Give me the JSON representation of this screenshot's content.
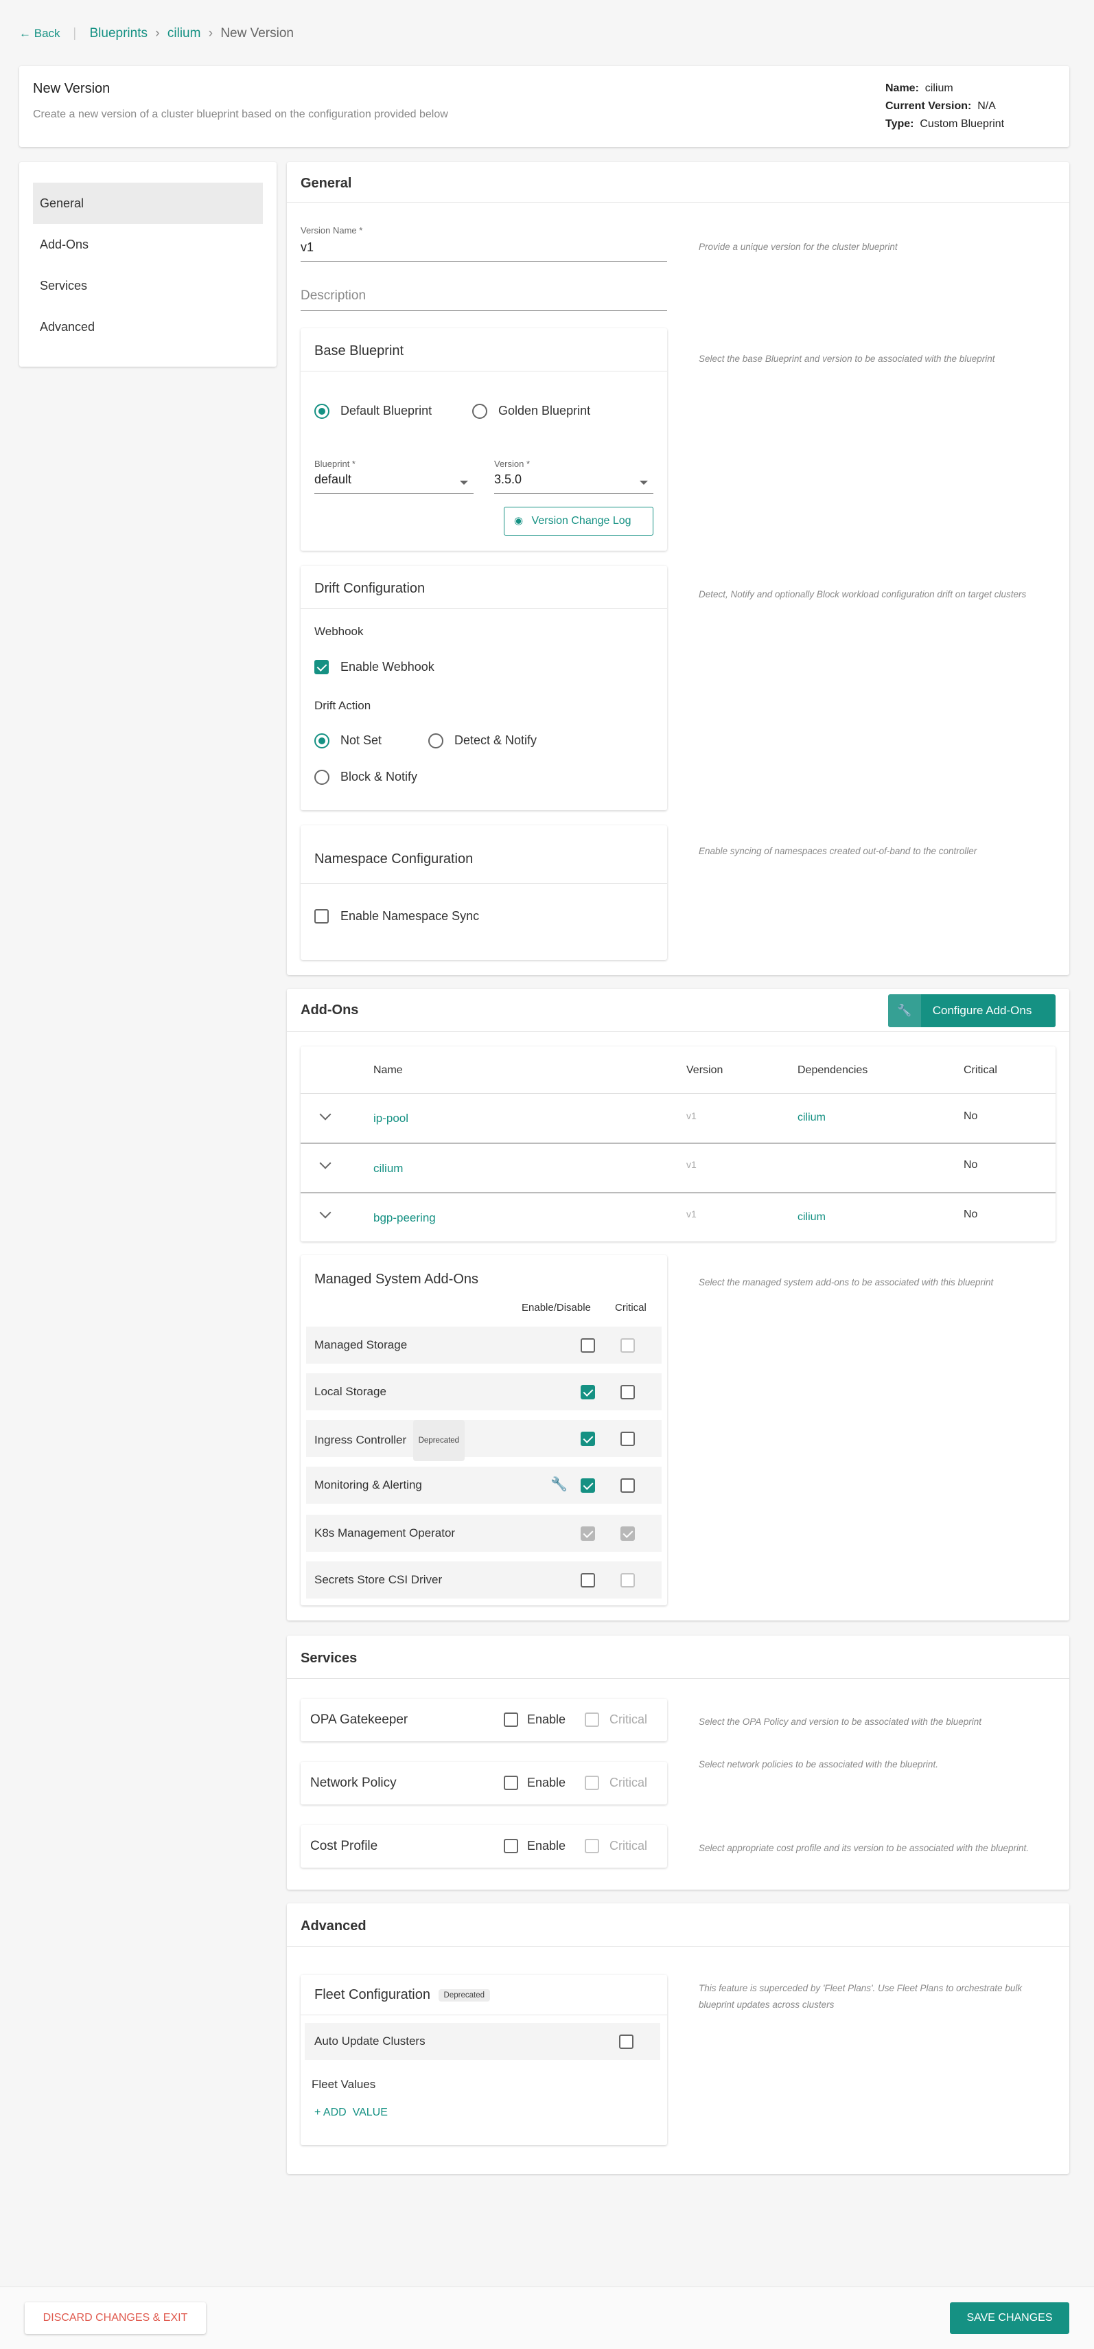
{
  "breadcrumb": {
    "back": "Back",
    "items": [
      "Blueprints",
      "cilium"
    ],
    "separator": "›",
    "current": "New Version"
  },
  "header": {
    "title": "New Version",
    "subtitle": "Create a new version of a cluster blueprint based on the configuration provided below",
    "meta": {
      "name_label": "Name:",
      "name_value": "cilium",
      "version_label": "Current Version:",
      "version_value": "N/A",
      "type_label": "Type:",
      "type_value": "Custom Blueprint"
    }
  },
  "sidebar": {
    "items": [
      {
        "label": "General",
        "active": true
      },
      {
        "label": "Add-Ons",
        "active": false
      },
      {
        "label": "Services",
        "active": false
      },
      {
        "label": "Advanced",
        "active": false
      }
    ]
  },
  "general": {
    "title": "General",
    "version_name_label": "Version Name *",
    "version_name_value": "v1",
    "version_name_hint": "Provide a unique version for the cluster blueprint",
    "description_placeholder": "Description",
    "base_blueprint": {
      "title": "Base Blueprint",
      "hint": "Select the base Blueprint and version to be associated with the blueprint",
      "option_default": "Default Blueprint",
      "option_golden": "Golden Blueprint",
      "selected": "Default Blueprint",
      "blueprint_label": "Blueprint *",
      "blueprint_value": "default",
      "version_label": "Version *",
      "version_value": "3.5.0",
      "change_log_button": "Version Change Log"
    },
    "drift": {
      "title": "Drift Configuration",
      "hint": "Detect, Notify and optionally Block workload configuration drift on target clusters",
      "webhook_label": "Webhook",
      "enable_webhook": "Enable Webhook",
      "enable_webhook_checked": true,
      "action_label": "Drift Action",
      "options": [
        "Not Set",
        "Detect & Notify",
        "Block & Notify"
      ],
      "selected": "Not Set"
    },
    "namespace": {
      "title": "Namespace Configuration",
      "hint": "Enable syncing of namespaces created out-of-band to the controller",
      "enable_sync": "Enable Namespace Sync",
      "enable_sync_checked": false
    }
  },
  "addons": {
    "title": "Add-Ons",
    "configure_button": "Configure Add-Ons",
    "columns": [
      "Name",
      "Version",
      "Dependencies",
      "Critical"
    ],
    "rows": [
      {
        "name": "ip-pool",
        "version": "v1",
        "dependencies": "cilium",
        "critical": "No"
      },
      {
        "name": "cilium",
        "version": "v1",
        "dependencies": "",
        "critical": "No"
      },
      {
        "name": "bgp-peering",
        "version": "v1",
        "dependencies": "cilium",
        "critical": "No"
      }
    ],
    "managed": {
      "title": "Managed System Add-Ons",
      "hint": "Select the managed system add-ons to be associated with this blueprint",
      "col_enable": "Enable/Disable",
      "col_critical": "Critical",
      "rows": [
        {
          "name": "Managed Storage",
          "badge": "",
          "enabled": false,
          "enable_disabled": false,
          "critical": false,
          "critical_disabled": true,
          "wrench": false
        },
        {
          "name": "Local Storage",
          "badge": "",
          "enabled": true,
          "enable_disabled": false,
          "critical": false,
          "critical_disabled": false,
          "wrench": false
        },
        {
          "name": "Ingress Controller",
          "badge": "Deprecated",
          "enabled": true,
          "enable_disabled": false,
          "critical": false,
          "critical_disabled": false,
          "wrench": false
        },
        {
          "name": "Monitoring & Alerting",
          "badge": "",
          "enabled": true,
          "enable_disabled": false,
          "critical": false,
          "critical_disabled": false,
          "wrench": true
        },
        {
          "name": "K8s Management Operator",
          "badge": "",
          "enabled": true,
          "enable_disabled": true,
          "critical": true,
          "critical_disabled": true,
          "wrench": false
        },
        {
          "name": "Secrets Store CSI Driver",
          "badge": "",
          "enabled": false,
          "enable_disabled": false,
          "critical": false,
          "critical_disabled": true,
          "wrench": false
        }
      ]
    }
  },
  "services": {
    "title": "Services",
    "enable_label": "Enable",
    "critical_label": "Critical",
    "items": [
      {
        "name": "OPA Gatekeeper",
        "hint": "Select the OPA Policy and version to be associated with the blueprint"
      },
      {
        "name": "Network Policy",
        "hint": "Select network policies to be associated with the blueprint."
      },
      {
        "name": "Cost Profile",
        "hint": "Select appropriate cost profile and its version to be associated with the blueprint."
      }
    ]
  },
  "advanced": {
    "title": "Advanced",
    "fleet_title": "Fleet Configuration",
    "fleet_badge": "Deprecated",
    "fleet_hint": "This feature is superceded by 'Fleet Plans'. Use Fleet Plans to orchestrate bulk blueprint updates across clusters",
    "auto_update": "Auto Update Clusters",
    "fleet_values": "Fleet Values",
    "add_value": "+ ADD  VALUE"
  },
  "footer": {
    "discard": "DISCARD CHANGES & EXIT",
    "save": "SAVE CHANGES"
  },
  "colors": {
    "accent": "#159183",
    "danger": "#e05a4e"
  }
}
